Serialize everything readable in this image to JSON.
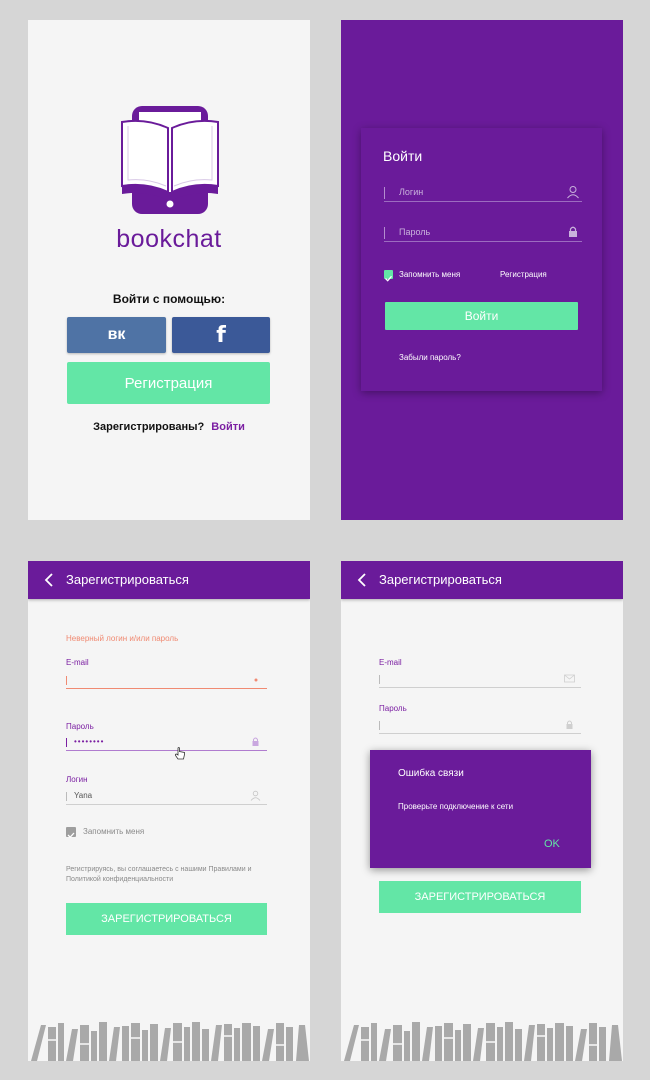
{
  "colors": {
    "brand_purple": "#6a1b9a",
    "accent_green": "#63e6a6",
    "vk_blue": "#4f73a5",
    "fb_blue": "#3b5998",
    "error": "#f08a72"
  },
  "screen1": {
    "logo_text": "bookchat",
    "login_with_label": "Войти с помощью:",
    "vk_icon_text": "вк",
    "fb_icon_text": "f",
    "register_button": "Регистрация",
    "registered_question": "Зарегистрированы?",
    "login_link": "Войти"
  },
  "screen2": {
    "title": "Войти",
    "login_placeholder": "Логин",
    "password_placeholder": "Пароль",
    "remember_me": "Запомнить меня",
    "register_link": "Регистрация",
    "login_button": "Войти",
    "forgot_password": "Забыли пароль?"
  },
  "screen3": {
    "appbar_title": "Зарегистрироваться",
    "error_text": "Неверный логин и/или пароль",
    "email_label": "E-mail",
    "password_label": "Пароль",
    "password_value": "••••••••",
    "login_label": "Логин",
    "login_value": "Yana",
    "remember_me": "Запомнить меня",
    "terms_text": "Регистрируясь, вы соглашаетесь с нашими Правилами и Политикой конфиденциальности",
    "register_button": "ЗАРЕГИСТРИРОВАТЬСЯ"
  },
  "screen4": {
    "appbar_title": "Зарегистрироваться",
    "email_label": "E-mail",
    "password_label": "Пароль",
    "dialog_title": "Ошибка связи",
    "dialog_message": "Проверьте подключение к сети",
    "dialog_ok": "OK",
    "register_button": "ЗАРЕГИСТРИРОВАТЬСЯ"
  }
}
